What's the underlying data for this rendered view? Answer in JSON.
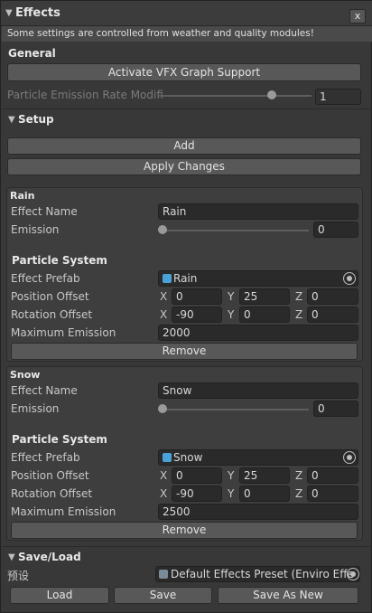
{
  "header": {
    "title": "Effects",
    "close_label": "x"
  },
  "notice": "Some settings are controlled from weather and quality modules!",
  "general": {
    "title": "General",
    "vfx_button": "Activate VFX Graph Support",
    "rate_label": "Particle Emission Rate Modifi",
    "rate_value": "1",
    "rate_level": 0.74
  },
  "setup": {
    "title": "Setup",
    "add_button": "Add",
    "apply_button": "Apply Changes"
  },
  "effects": [
    {
      "title": "Rain",
      "name_label": "Effect Name",
      "name_value": "Rain",
      "emission_label": "Emission",
      "emission_value": "0",
      "emission_level": 0,
      "ps_title": "Particle System",
      "prefab_label": "Effect Prefab",
      "prefab_value": "Rain",
      "pos_label": "Position Offset",
      "pos": {
        "x_axis": "X",
        "x": "0",
        "y_axis": "Y",
        "y": "25",
        "z_axis": "Z",
        "z": "0"
      },
      "rot_label": "Rotation Offset",
      "rot": {
        "x_axis": "X",
        "x": "-90",
        "y_axis": "Y",
        "y": "0",
        "z_axis": "Z",
        "z": "0"
      },
      "max_label": "Maximum Emission",
      "max_value": "2000",
      "remove_button": "Remove"
    },
    {
      "title": "Snow",
      "name_label": "Effect Name",
      "name_value": "Snow",
      "emission_label": "Emission",
      "emission_value": "0",
      "emission_level": 0,
      "ps_title": "Particle System",
      "prefab_label": "Effect Prefab",
      "prefab_value": "Snow",
      "pos_label": "Position Offset",
      "pos": {
        "x_axis": "X",
        "x": "0",
        "y_axis": "Y",
        "y": "25",
        "z_axis": "Z",
        "z": "0"
      },
      "rot_label": "Rotation Offset",
      "rot": {
        "x_axis": "X",
        "x": "-90",
        "y_axis": "Y",
        "y": "0",
        "z_axis": "Z",
        "z": "0"
      },
      "max_label": "Maximum Emission",
      "max_value": "2500",
      "remove_button": "Remove"
    }
  ],
  "saveload": {
    "title": "Save/Load",
    "preset_label": "预设",
    "preset_value": "Default Effects Preset (Enviro Effe",
    "load_button": "Load",
    "save_button": "Save",
    "save_as_new_button": "Save As New"
  },
  "colors": {
    "background": "#383838",
    "field": "#2a2a2a",
    "button": "#585858",
    "prefab_icon": "#4aa3d8"
  }
}
